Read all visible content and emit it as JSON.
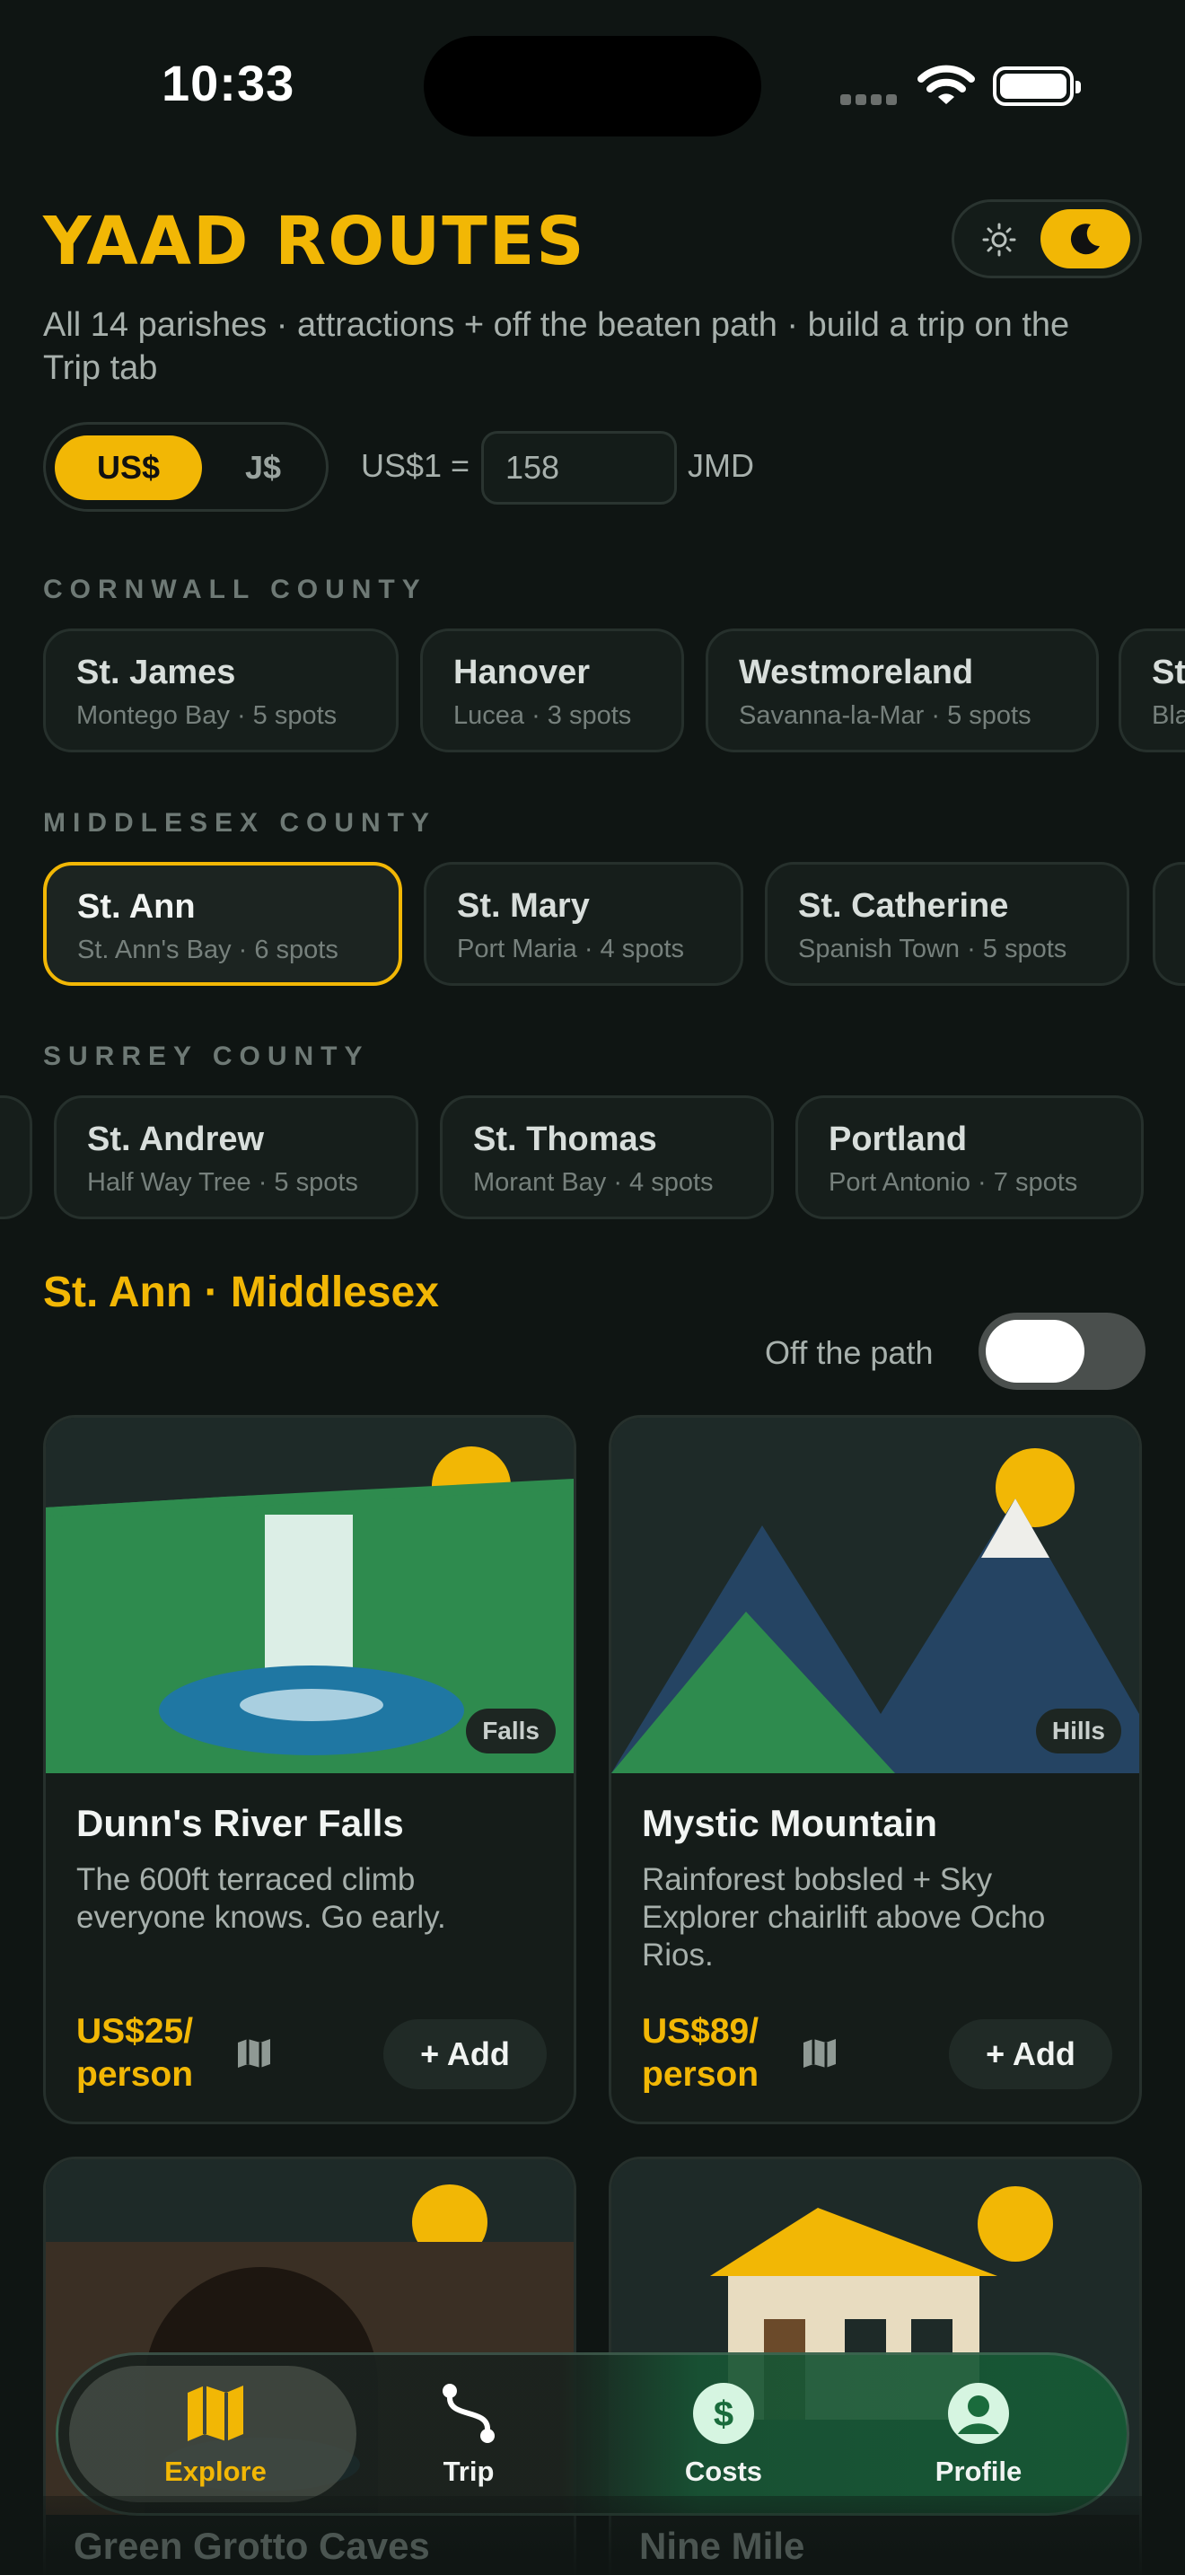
{
  "status": {
    "time": "10:33"
  },
  "app": {
    "title": "YAAD ROUTES",
    "subtitle": "All 14 parishes · attractions + off the beaten path · build a trip on the Trip tab"
  },
  "theme_toggle": {
    "light_icon": "sun-icon",
    "dark_icon": "moon-icon",
    "selected": "dark"
  },
  "currency": {
    "options": [
      "US$",
      "J$"
    ],
    "selected": "US$",
    "rate_prefix": "US$1 =",
    "rate_value": "158",
    "rate_unit": "JMD"
  },
  "counties": [
    {
      "label": "CORNWALL COUNTY",
      "parishes": [
        {
          "name": "St. James",
          "sub": "Montego Bay · 5 spots"
        },
        {
          "name": "Hanover",
          "sub": "Lucea · 3 spots"
        },
        {
          "name": "Westmoreland",
          "sub": "Savanna-la-Mar · 5 spots"
        },
        {
          "name": "St",
          "sub": "Bla"
        }
      ]
    },
    {
      "label": "MIDDLESEX COUNTY",
      "parishes": [
        {
          "name": "St. Ann",
          "sub": "St. Ann's Bay · 6 spots",
          "active": true
        },
        {
          "name": "St. Mary",
          "sub": "Port Maria · 4 spots"
        },
        {
          "name": "St. Catherine",
          "sub": "Spanish Town · 5 spots"
        }
      ]
    },
    {
      "label": "SURREY COUNTY",
      "parishes": [
        {
          "name": "St. Andrew",
          "sub": "Half Way Tree · 5 spots"
        },
        {
          "name": "St. Thomas",
          "sub": "Morant Bay · 4 spots"
        },
        {
          "name": "Portland",
          "sub": "Port Antonio · 7 spots"
        }
      ]
    }
  ],
  "section": {
    "heading": "St. Ann · Middlesex",
    "off_path_label": "Off the path",
    "off_path_on": false
  },
  "cards": [
    {
      "title": "Dunn's River Falls",
      "desc": "The 600ft terraced climb everyone knows. Go early.",
      "badge": "Falls",
      "price": "US$25/ person",
      "add": "+ Add"
    },
    {
      "title": "Mystic Mountain",
      "desc": "Rainforest bobsled + Sky Explorer chairlift above Ocho Rios.",
      "badge": "Hills",
      "price": "US$89/ person",
      "add": "+ Add"
    },
    {
      "title": "Green Grotto Caves"
    },
    {
      "title": "Nine Mile"
    }
  ],
  "tabbar": {
    "tabs": [
      {
        "label": "Explore",
        "icon": "map-icon",
        "active": true
      },
      {
        "label": "Trip",
        "icon": "route-icon"
      },
      {
        "label": "Costs",
        "icon": "dollar-icon"
      },
      {
        "label": "Profile",
        "icon": "profile-icon"
      }
    ]
  },
  "colors": {
    "accent": "#f2b705",
    "background": "#0f1513",
    "card": "#151c19",
    "green": "#2e8b4e"
  }
}
